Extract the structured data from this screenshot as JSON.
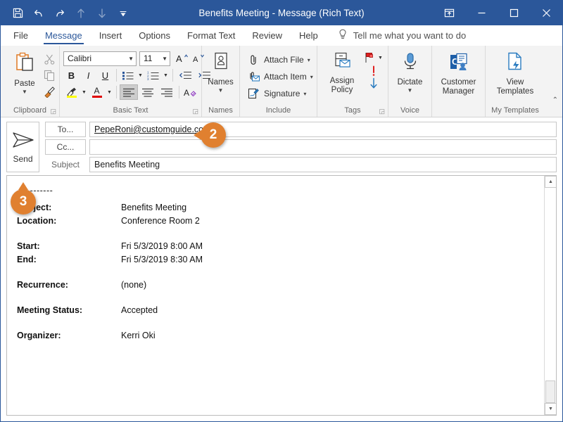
{
  "window": {
    "title": "Benefits Meeting  -  Message (Rich Text)",
    "quick_access": [
      {
        "name": "save-icon",
        "label": "Save"
      },
      {
        "name": "undo-icon",
        "label": "Undo"
      },
      {
        "name": "redo-icon",
        "label": "Redo"
      },
      {
        "name": "previous-item-icon",
        "label": "Previous Item"
      },
      {
        "name": "next-item-icon",
        "label": "Next Item"
      },
      {
        "name": "customize-quick-access-toolbar-icon",
        "label": "Customize Quick Access Toolbar"
      }
    ],
    "controls": [
      {
        "name": "ribbon-display-options",
        "label": "Ribbon Display Options"
      },
      {
        "name": "minimize",
        "label": "Minimize"
      },
      {
        "name": "maximize",
        "label": "Maximize"
      },
      {
        "name": "close",
        "label": "Close"
      }
    ],
    "accent_color": "#2b579a",
    "badge_color": "#e08030"
  },
  "tabs": [
    {
      "label": "File",
      "active": false
    },
    {
      "label": "Message",
      "active": true
    },
    {
      "label": "Insert",
      "active": false
    },
    {
      "label": "Options",
      "active": false
    },
    {
      "label": "Format Text",
      "active": false
    },
    {
      "label": "Review",
      "active": false
    },
    {
      "label": "Help",
      "active": false
    }
  ],
  "tell_me": {
    "label": "Tell me what you want to do",
    "icon": "lightbulb-icon"
  },
  "ribbon": {
    "groups": [
      {
        "name": "clipboard",
        "label": "Clipboard",
        "has_dialog_launcher": true,
        "paste_label": "Paste",
        "items": [
          {
            "label": "Cut",
            "icon": "scissors-icon",
            "enabled": false
          },
          {
            "label": "Copy",
            "icon": "copy-icon",
            "enabled": false
          },
          {
            "label": "Format Painter",
            "icon": "format-painter-icon",
            "enabled": true
          }
        ]
      },
      {
        "name": "basic-text",
        "label": "Basic Text",
        "has_dialog_launcher": true,
        "font_name": "Calibri",
        "font_size": "11",
        "buttons": [
          {
            "label": "Grow Font",
            "icon": "grow-font-icon"
          },
          {
            "label": "Shrink Font",
            "icon": "shrink-font-icon"
          },
          {
            "label": "Bold",
            "icon": "bold-icon"
          },
          {
            "label": "Italic",
            "icon": "italic-icon"
          },
          {
            "label": "Underline",
            "icon": "underline-icon"
          },
          {
            "label": "Bullets",
            "icon": "bullets-icon"
          },
          {
            "label": "Numbering",
            "icon": "numbering-icon"
          },
          {
            "label": "Decrease Indent",
            "icon": "decrease-indent-icon"
          },
          {
            "label": "Increase Indent",
            "icon": "increase-indent-icon"
          },
          {
            "label": "Text Highlight Color",
            "icon": "highlight-icon"
          },
          {
            "label": "Font Color",
            "icon": "font-color-icon"
          },
          {
            "label": "Align Left",
            "icon": "align-left-icon",
            "active": true
          },
          {
            "label": "Center",
            "icon": "align-center-icon"
          },
          {
            "label": "Align Right",
            "icon": "align-right-icon"
          },
          {
            "label": "Clear All Formatting",
            "icon": "clear-formatting-icon"
          }
        ]
      },
      {
        "name": "names",
        "label": "Names",
        "button_label": "Names",
        "icon": "address-book-icon"
      },
      {
        "name": "include",
        "label": "Include",
        "items": [
          {
            "label": "Attach File",
            "icon": "paperclip-icon",
            "has_caret": true
          },
          {
            "label": "Attach Item",
            "icon": "attach-item-icon",
            "has_caret": true
          },
          {
            "label": "Signature",
            "icon": "signature-icon",
            "has_caret": true
          }
        ]
      },
      {
        "name": "tags",
        "label": "Tags",
        "has_dialog_launcher": true,
        "assign_policy_label": "Assign Policy",
        "items": [
          {
            "label": "Follow Up",
            "icon": "flag-icon",
            "has_caret": true
          },
          {
            "label": "High Importance",
            "icon": "high-importance-icon"
          },
          {
            "label": "Low Importance",
            "icon": "low-importance-icon"
          }
        ]
      },
      {
        "name": "voice",
        "label": "Voice",
        "button_label": "Dictate",
        "icon": "microphone-icon",
        "has_caret": true
      },
      {
        "name": "customer-manager",
        "label": "",
        "button_label": "Customer Manager",
        "icon": "customer-manager-icon"
      },
      {
        "name": "my-templates",
        "label": "My Templates",
        "button_label": "View Templates",
        "icon": "view-templates-icon"
      }
    ],
    "collapse_label": "Collapse the Ribbon"
  },
  "compose": {
    "send_label": "Send",
    "send_icon": "send-arrow-icon",
    "to_button": "To...",
    "to_value": "PepeRoni@customguide.com;",
    "cc_button": "Cc...",
    "cc_value": "",
    "subject_label": "Subject",
    "subject_value": "Benefits Meeting"
  },
  "message_body": {
    "divider": "-----------",
    "rows": [
      {
        "key": "Subject:",
        "value": "Benefits Meeting",
        "gap_after": false
      },
      {
        "key": "Location:",
        "value": "Conference Room 2",
        "gap_after": true
      },
      {
        "key": "Start:",
        "value": "Fri 5/3/2019 8:00 AM",
        "gap_after": false
      },
      {
        "key": "End:",
        "value": "Fri 5/3/2019 8:30 AM",
        "gap_after": true
      },
      {
        "key": "Recurrence:",
        "value": "(none)",
        "gap_after": true
      },
      {
        "key": "Meeting Status:",
        "value": "Accepted",
        "gap_after": true
      },
      {
        "key": "Organizer:",
        "value": "Kerri Oki",
        "gap_after": false
      }
    ]
  },
  "scrollbar": {
    "up_label": "Line up",
    "down_label": "Line down"
  },
  "callouts": [
    {
      "number": "2",
      "target": "to-field"
    },
    {
      "number": "3",
      "target": "send-button"
    }
  ]
}
